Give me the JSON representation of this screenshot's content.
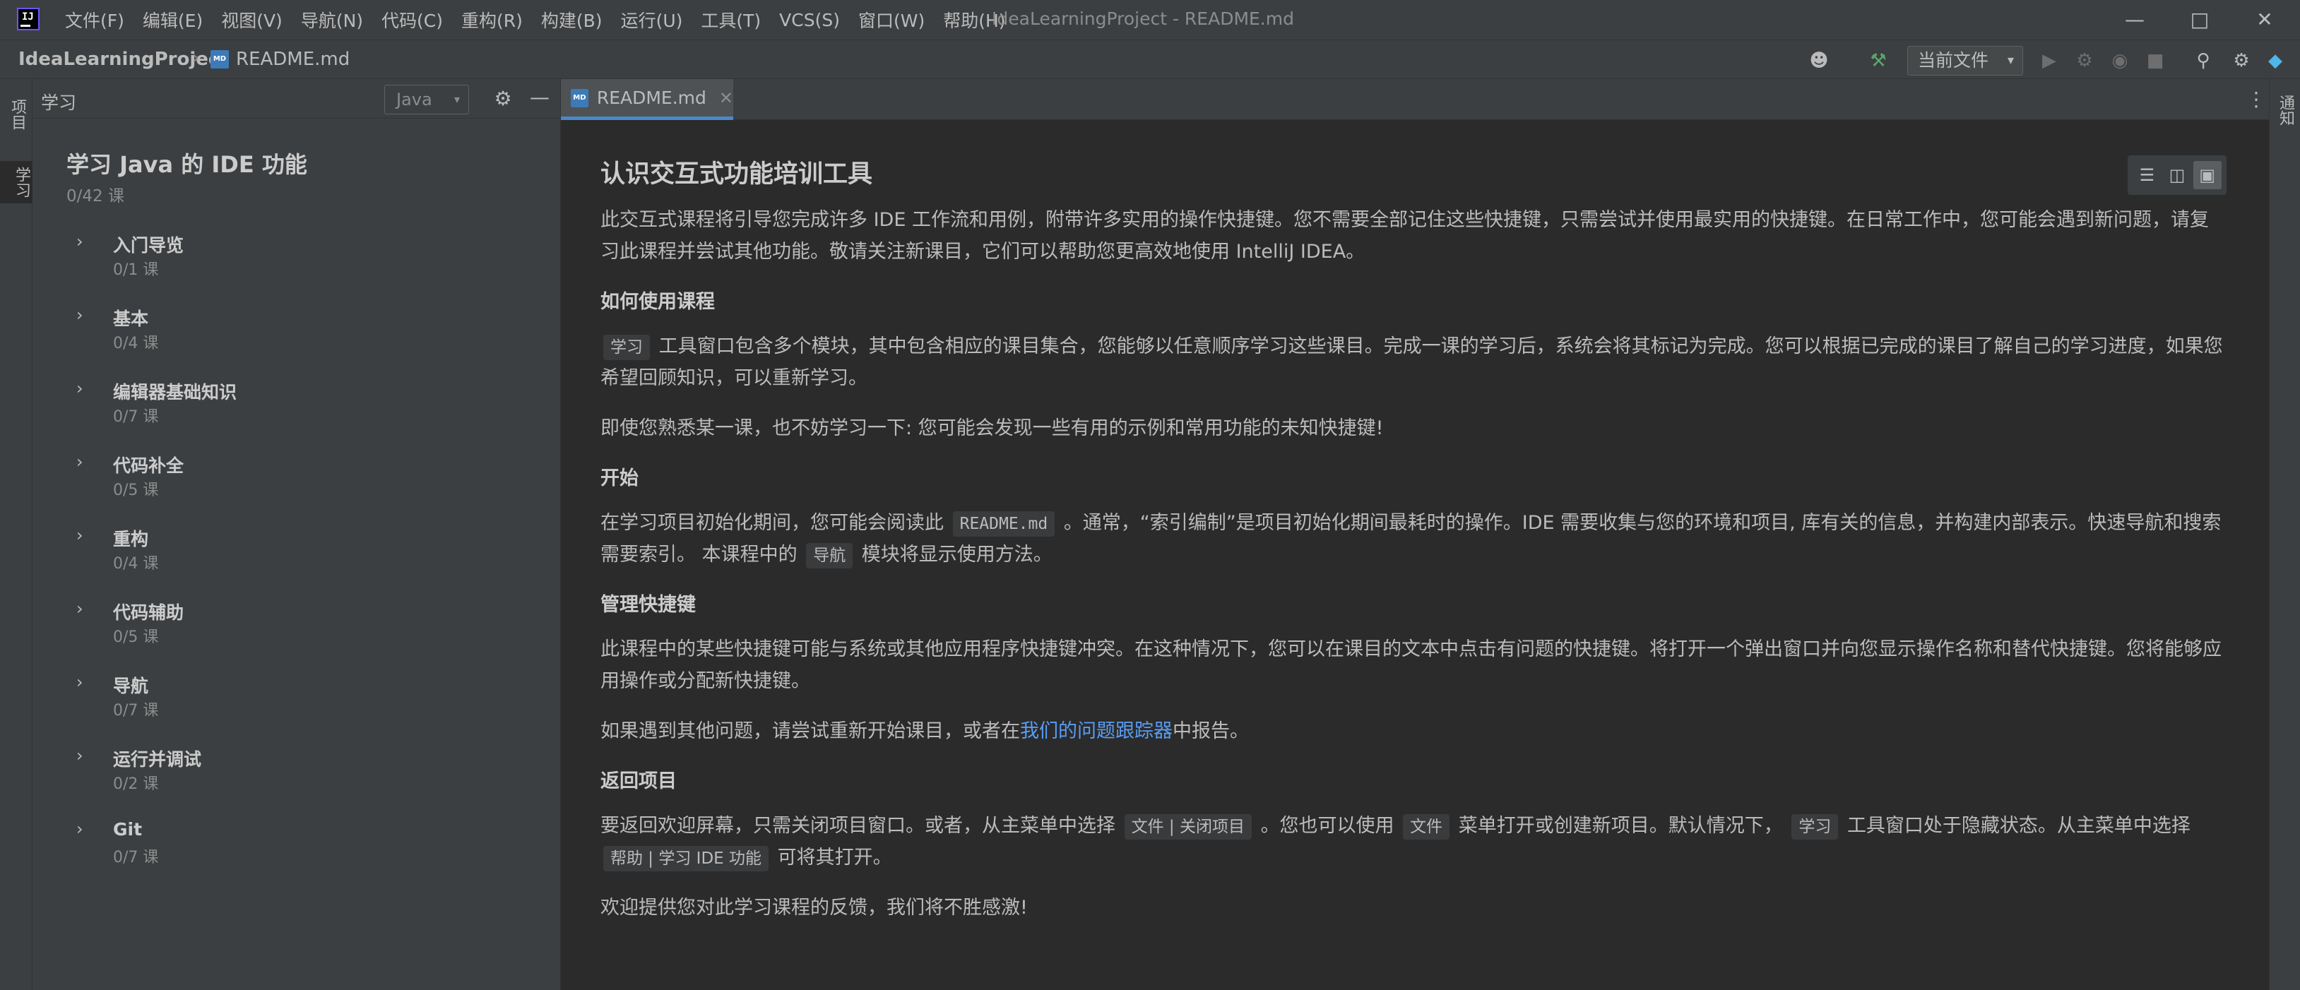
{
  "titlebar": {
    "menu": [
      "文件(F)",
      "编辑(E)",
      "视图(V)",
      "导航(N)",
      "代码(C)",
      "重构(R)",
      "构建(B)",
      "运行(U)",
      "工具(T)",
      "VCS(S)",
      "窗口(W)",
      "帮助(H)"
    ],
    "window_title": "IdeaLearningProject - README.md"
  },
  "navbar": {
    "project": "IdeaLearningProject",
    "file": "README.md",
    "md_icon": "MD",
    "run_config": "当前文件"
  },
  "stripe": {
    "project_label": "项目",
    "learn_label": "学习",
    "notifications_label": "通知"
  },
  "learn": {
    "header_title": "学习",
    "language": "Java",
    "course_title": "学习 Java 的 IDE 功能",
    "course_progress": "0/42 课",
    "modules": [
      {
        "name": "入门导览",
        "count": "0/1 课"
      },
      {
        "name": "基本",
        "count": "0/4 课"
      },
      {
        "name": "编辑器基础知识",
        "count": "0/7 课"
      },
      {
        "name": "代码补全",
        "count": "0/5 课"
      },
      {
        "name": "重构",
        "count": "0/4 课"
      },
      {
        "name": "代码辅助",
        "count": "0/5 课"
      },
      {
        "name": "导航",
        "count": "0/7 课"
      },
      {
        "name": "运行并调试",
        "count": "0/2 课"
      },
      {
        "name": "Git",
        "count": "0/7 课"
      }
    ]
  },
  "editor": {
    "tab_label": "README.md",
    "heading": "认识交互式功能培训工具",
    "intro": "此交互式课程将引导您完成许多 IDE 工作流和用例，附带许多实用的操作快捷键。您不需要全部记住这些快捷键，只需尝试并使用最实用的快捷键。在日常工作中，您可能会遇到新问题，请复习此课程并尝试其他功能。敬请关注新课目，它们可以帮助您更高效地使用 IntelliJ IDEA。",
    "h_how": "如何使用课程",
    "how_code": "学习",
    "how_text": "工具窗口包含多个模块，其中包含相应的课目集合，您能够以任意顺序学习这些课目。完成一课的学习后，系统会将其标记为完成。您可以根据已完成的课目了解自己的学习进度，如果您希望回顾知识，可以重新学习。",
    "tip": "即使您熟悉某一课，也不妨学习一下: 您可能会发现一些有用的示例和常用功能的未知快捷键!",
    "h_start": "开始",
    "start_a": "在学习项目初始化期间，您可能会阅读此",
    "start_code": "README.md",
    "start_b": "。通常，“索引编制”是项目初始化期间最耗时的操作。IDE 需要收集与您的环境和项目, 库有关的信息，并构建内部表示。快速导航和搜索需要索引。 本课程中的",
    "start_code2": "导航",
    "start_c": "模块将显示使用方法。",
    "h_shortcuts": "管理快捷键",
    "shortcuts": "此课程中的某些快捷键可能与系统或其他应用程序快捷键冲突。在这种情况下，您可以在课目的文本中点击有问题的快捷键。将打开一个弹出窗口并向您显示操作名称和替代快捷键。您将能够应用操作或分配新快捷键。",
    "issues_a": "如果遇到其他问题，请尝试重新开始课目，或者在",
    "issues_link": "我们的问题跟踪器",
    "issues_b": "中报告。",
    "h_return": "返回项目",
    "ret_a": "要返回欢迎屏幕，只需关闭项目窗口。或者，从主菜单中选择",
    "ret_code1": "文件 | 关闭项目",
    "ret_b": "。您也可以使用",
    "ret_code2": "文件",
    "ret_c": "菜单打开或创建新项目。默认情况下，",
    "ret_code3": "学习",
    "ret_d": "工具窗口处于隐藏状态。从主菜单中选择",
    "ret_code4": "帮助 | 学习 IDE 功能",
    "ret_e": "可将其打开。",
    "feedback": "欢迎提供您对此学习课程的反馈，我们将不胜感激!"
  }
}
